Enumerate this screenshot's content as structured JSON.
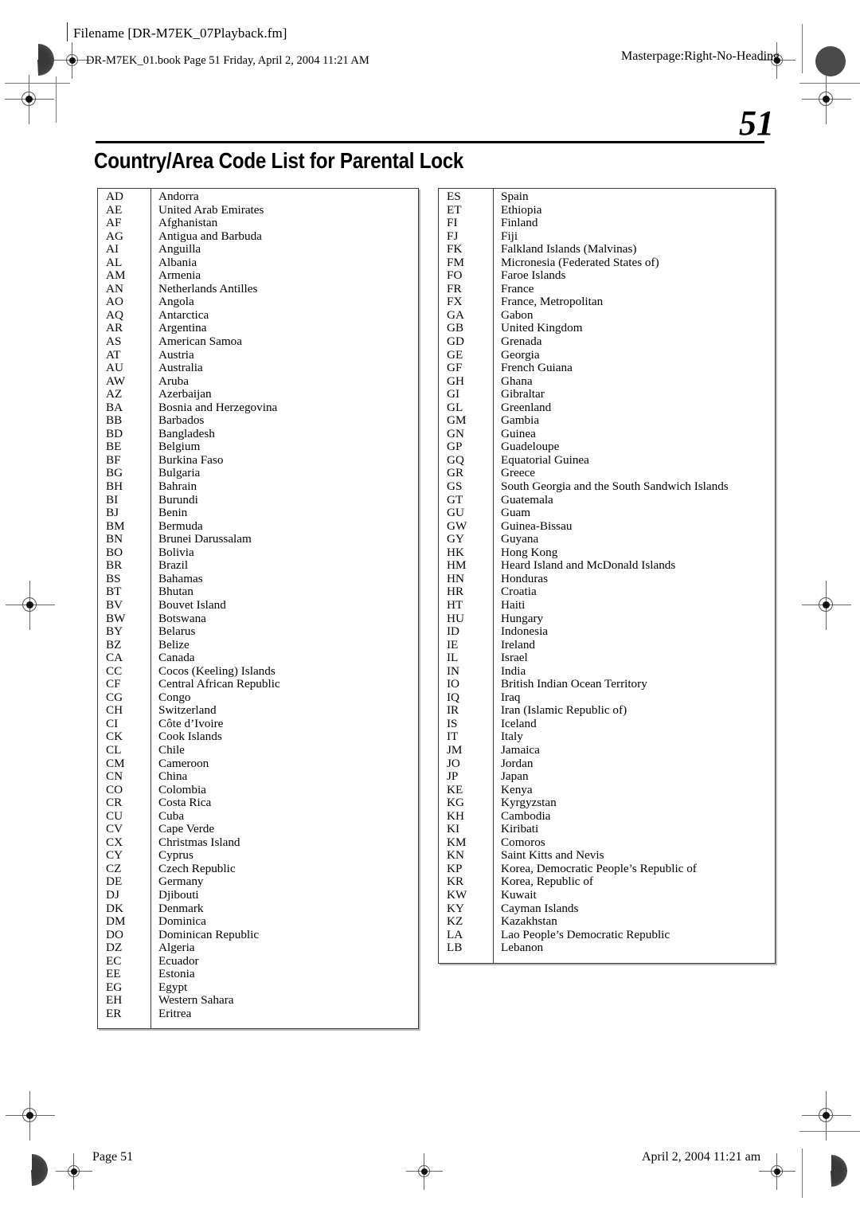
{
  "header": {
    "filename": "Filename [DR-M7EK_07Playback.fm]",
    "book_line": "DR-M7EK_01.book  Page 51  Friday, April 2, 2004  11:21 AM",
    "masterpage": "Masterpage:Right-No-Heading"
  },
  "page_number": "51",
  "title": "Country/Area Code List for Parental Lock",
  "footer": {
    "left": "Page 51",
    "right": "April 2, 2004 11:21 am"
  },
  "tables": {
    "left": [
      {
        "code": "AD",
        "name": "Andorra"
      },
      {
        "code": "AE",
        "name": "United Arab Emirates"
      },
      {
        "code": "AF",
        "name": "Afghanistan"
      },
      {
        "code": "AG",
        "name": "Antigua and Barbuda"
      },
      {
        "code": "AI",
        "name": "Anguilla"
      },
      {
        "code": "AL",
        "name": "Albania"
      },
      {
        "code": "AM",
        "name": "Armenia"
      },
      {
        "code": "AN",
        "name": "Netherlands Antilles"
      },
      {
        "code": "AO",
        "name": "Angola"
      },
      {
        "code": "AQ",
        "name": "Antarctica"
      },
      {
        "code": "AR",
        "name": "Argentina"
      },
      {
        "code": "AS",
        "name": "American Samoa"
      },
      {
        "code": "AT",
        "name": "Austria"
      },
      {
        "code": "AU",
        "name": "Australia"
      },
      {
        "code": "AW",
        "name": "Aruba"
      },
      {
        "code": "AZ",
        "name": "Azerbaijan"
      },
      {
        "code": "BA",
        "name": "Bosnia and Herzegovina"
      },
      {
        "code": "BB",
        "name": "Barbados"
      },
      {
        "code": "BD",
        "name": "Bangladesh"
      },
      {
        "code": "BE",
        "name": "Belgium"
      },
      {
        "code": "BF",
        "name": "Burkina Faso"
      },
      {
        "code": "BG",
        "name": "Bulgaria"
      },
      {
        "code": "BH",
        "name": "Bahrain"
      },
      {
        "code": "BI",
        "name": "Burundi"
      },
      {
        "code": "BJ",
        "name": "Benin"
      },
      {
        "code": "BM",
        "name": "Bermuda"
      },
      {
        "code": "BN",
        "name": "Brunei Darussalam"
      },
      {
        "code": "BO",
        "name": "Bolivia"
      },
      {
        "code": "BR",
        "name": "Brazil"
      },
      {
        "code": "BS",
        "name": "Bahamas"
      },
      {
        "code": "BT",
        "name": "Bhutan"
      },
      {
        "code": "BV",
        "name": "Bouvet Island"
      },
      {
        "code": "BW",
        "name": "Botswana"
      },
      {
        "code": "BY",
        "name": "Belarus"
      },
      {
        "code": "BZ",
        "name": "Belize"
      },
      {
        "code": "CA",
        "name": "Canada"
      },
      {
        "code": "CC",
        "name": "Cocos (Keeling) Islands"
      },
      {
        "code": "CF",
        "name": "Central African Republic"
      },
      {
        "code": "CG",
        "name": "Congo"
      },
      {
        "code": "CH",
        "name": "Switzerland"
      },
      {
        "code": "CI",
        "name": "Côte d’Ivoire"
      },
      {
        "code": "CK",
        "name": "Cook Islands"
      },
      {
        "code": "CL",
        "name": "Chile"
      },
      {
        "code": "CM",
        "name": "Cameroon"
      },
      {
        "code": "CN",
        "name": "China"
      },
      {
        "code": "CO",
        "name": "Colombia"
      },
      {
        "code": "CR",
        "name": "Costa Rica"
      },
      {
        "code": "CU",
        "name": "Cuba"
      },
      {
        "code": "CV",
        "name": "Cape Verde"
      },
      {
        "code": "CX",
        "name": "Christmas Island"
      },
      {
        "code": "CY",
        "name": "Cyprus"
      },
      {
        "code": "CZ",
        "name": "Czech Republic"
      },
      {
        "code": "DE",
        "name": "Germany"
      },
      {
        "code": "DJ",
        "name": "Djibouti"
      },
      {
        "code": "DK",
        "name": "Denmark"
      },
      {
        "code": "DM",
        "name": "Dominica"
      },
      {
        "code": "DO",
        "name": "Dominican Republic"
      },
      {
        "code": "DZ",
        "name": "Algeria"
      },
      {
        "code": "EC",
        "name": "Ecuador"
      },
      {
        "code": "EE",
        "name": "Estonia"
      },
      {
        "code": "EG",
        "name": "Egypt"
      },
      {
        "code": "EH",
        "name": "Western Sahara"
      },
      {
        "code": "ER",
        "name": "Eritrea"
      }
    ],
    "right": [
      {
        "code": "ES",
        "name": "Spain"
      },
      {
        "code": "ET",
        "name": "Ethiopia"
      },
      {
        "code": "FI",
        "name": "Finland"
      },
      {
        "code": "FJ",
        "name": "Fiji"
      },
      {
        "code": "FK",
        "name": "Falkland Islands (Malvinas)"
      },
      {
        "code": "FM",
        "name": "Micronesia (Federated States of)"
      },
      {
        "code": "FO",
        "name": "Faroe Islands"
      },
      {
        "code": "FR",
        "name": "France"
      },
      {
        "code": "FX",
        "name": "France, Metropolitan"
      },
      {
        "code": "GA",
        "name": "Gabon"
      },
      {
        "code": "GB",
        "name": "United Kingdom"
      },
      {
        "code": "GD",
        "name": "Grenada"
      },
      {
        "code": "GE",
        "name": "Georgia"
      },
      {
        "code": "GF",
        "name": "French Guiana"
      },
      {
        "code": "GH",
        "name": "Ghana"
      },
      {
        "code": "GI",
        "name": "Gibraltar"
      },
      {
        "code": "GL",
        "name": "Greenland"
      },
      {
        "code": "GM",
        "name": "Gambia"
      },
      {
        "code": "GN",
        "name": "Guinea"
      },
      {
        "code": "GP",
        "name": "Guadeloupe"
      },
      {
        "code": "GQ",
        "name": "Equatorial Guinea"
      },
      {
        "code": "GR",
        "name": "Greece"
      },
      {
        "code": "GS",
        "name": "South Georgia and the South Sandwich Islands"
      },
      {
        "code": "GT",
        "name": "Guatemala"
      },
      {
        "code": "GU",
        "name": "Guam"
      },
      {
        "code": "GW",
        "name": "Guinea-Bissau"
      },
      {
        "code": "GY",
        "name": "Guyana"
      },
      {
        "code": "HK",
        "name": "Hong Kong"
      },
      {
        "code": "HM",
        "name": "Heard Island and McDonald Islands"
      },
      {
        "code": "HN",
        "name": "Honduras"
      },
      {
        "code": "HR",
        "name": "Croatia"
      },
      {
        "code": "HT",
        "name": "Haiti"
      },
      {
        "code": "HU",
        "name": "Hungary"
      },
      {
        "code": "ID",
        "name": "Indonesia"
      },
      {
        "code": "IE",
        "name": "Ireland"
      },
      {
        "code": "IL",
        "name": "Israel"
      },
      {
        "code": "IN",
        "name": "India"
      },
      {
        "code": "IO",
        "name": "British Indian Ocean Territory"
      },
      {
        "code": "IQ",
        "name": "Iraq"
      },
      {
        "code": "IR",
        "name": "Iran (Islamic Republic of)"
      },
      {
        "code": "IS",
        "name": "Iceland"
      },
      {
        "code": "IT",
        "name": "Italy"
      },
      {
        "code": "JM",
        "name": "Jamaica"
      },
      {
        "code": "JO",
        "name": "Jordan"
      },
      {
        "code": "JP",
        "name": "Japan"
      },
      {
        "code": "KE",
        "name": "Kenya"
      },
      {
        "code": "KG",
        "name": "Kyrgyzstan"
      },
      {
        "code": "KH",
        "name": "Cambodia"
      },
      {
        "code": "KI",
        "name": "Kiribati"
      },
      {
        "code": "KM",
        "name": "Comoros"
      },
      {
        "code": "KN",
        "name": "Saint Kitts and Nevis"
      },
      {
        "code": "KP",
        "name": "Korea, Democratic People’s Republic of"
      },
      {
        "code": "KR",
        "name": "Korea, Republic of"
      },
      {
        "code": "KW",
        "name": "Kuwait"
      },
      {
        "code": "KY",
        "name": "Cayman Islands"
      },
      {
        "code": "KZ",
        "name": "Kazakhstan"
      },
      {
        "code": "LA",
        "name": "Lao People’s Democratic Republic"
      },
      {
        "code": "LB",
        "name": "Lebanon"
      }
    ]
  }
}
